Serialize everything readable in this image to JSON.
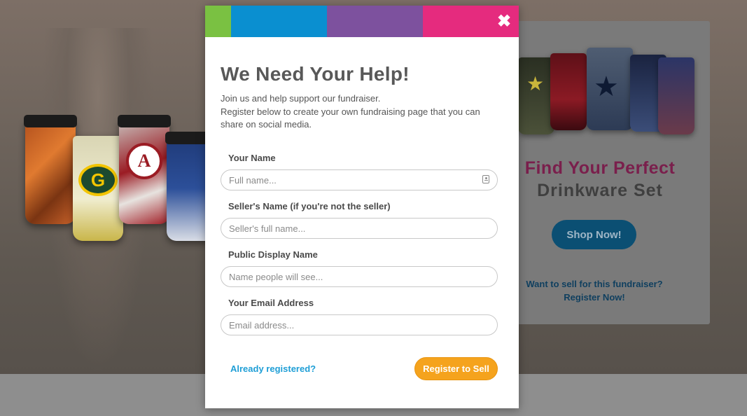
{
  "background": {
    "promo": {
      "title_line1": "Find Your Perfect",
      "title_line2": "Drinkware Set",
      "shop_button": "Shop Now!",
      "sell_link_line1": "Want to sell for this fundraiser?",
      "sell_link_line2": "Register Now!",
      "accent_color": "#e52b7e",
      "button_color": "#0a8fd0"
    }
  },
  "modal": {
    "color_bar": [
      "#7ac142",
      "#0a8fd0",
      "#7d519e",
      "#e52b7e"
    ],
    "close_icon": "close-icon",
    "title": "We Need Your Help!",
    "intro_line1": "Join us and help support our fundraiser.",
    "intro_line2": "Register below to create your own fundraising page that you can share on social media.",
    "fields": [
      {
        "label": "Your Name",
        "placeholder": "Full name..."
      },
      {
        "label": "Seller's Name (if you're not the seller)",
        "placeholder": "Seller's full name..."
      },
      {
        "label": "Public Display Name",
        "placeholder": "Name people will see..."
      },
      {
        "label": "Your Email Address",
        "placeholder": "Email address..."
      }
    ],
    "already_registered": "Already registered?",
    "register_button": "Register to Sell",
    "register_button_color": "#f5a31d",
    "link_color": "#1e9ed6"
  }
}
